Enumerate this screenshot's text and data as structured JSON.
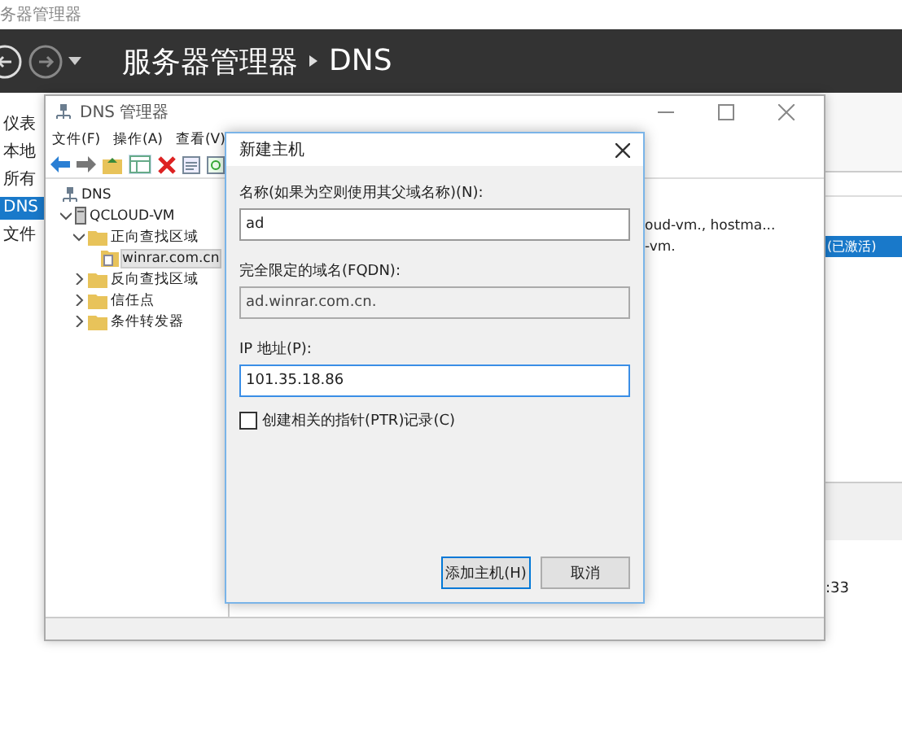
{
  "server_manager": {
    "title": "务器管理器",
    "crumb": "服务器管理器",
    "page": "DNS"
  },
  "sidebar": {
    "items": [
      {
        "label": "仪表",
        "selected": false
      },
      {
        "label": "本地",
        "selected": false
      },
      {
        "label": "所有",
        "selected": false
      },
      {
        "label": "DNS",
        "selected": true
      },
      {
        "label": "文件",
        "selected": false
      }
    ]
  },
  "background_pane": {
    "selected_row": "(已激活)",
    "time": ":33"
  },
  "dns_manager": {
    "title": "DNS 管理器",
    "menu": [
      "文件(F)",
      "操作(A)",
      "查看(V)"
    ],
    "tree": [
      {
        "label": "DNS",
        "kind": "dns",
        "selected": false,
        "children": [
          {
            "label": "QCLOUD-VM",
            "kind": "server",
            "selected": false,
            "expanded": true,
            "children": [
              {
                "label": "正向查找区域",
                "kind": "folder",
                "selected": false,
                "expanded": true,
                "children": [
                  {
                    "label": "winrar.com.cn",
                    "kind": "zone",
                    "selected": true
                  }
                ]
              },
              {
                "label": "反向查找区域",
                "kind": "folder",
                "selected": false,
                "expanded": false
              },
              {
                "label": "信任点",
                "kind": "folder",
                "selected": false,
                "expanded": false
              },
              {
                "label": "条件转发器",
                "kind": "folder",
                "selected": false,
                "expanded": false
              }
            ]
          }
        ]
      }
    ],
    "details": [
      "oud-vm., hostma...",
      "-vm."
    ]
  },
  "dialog": {
    "title": "新建主机",
    "fields": [
      {
        "label": "名称(如果为空则使用其父域名称)(N):",
        "value": "ad",
        "disabled": false
      },
      {
        "label": "完全限定的域名(FQDN):",
        "value": "ad.winrar.com.cn.",
        "disabled": true
      },
      {
        "label": "IP 地址(P):",
        "value": "101.35.18.86",
        "disabled": false
      }
    ],
    "checkbox": {
      "label": "创建相关的指针(PTR)记录(C)",
      "checked": false
    },
    "buttons": [
      {
        "label": "添加主机(H)",
        "default": true
      },
      {
        "label": "取消",
        "default": false
      }
    ]
  }
}
